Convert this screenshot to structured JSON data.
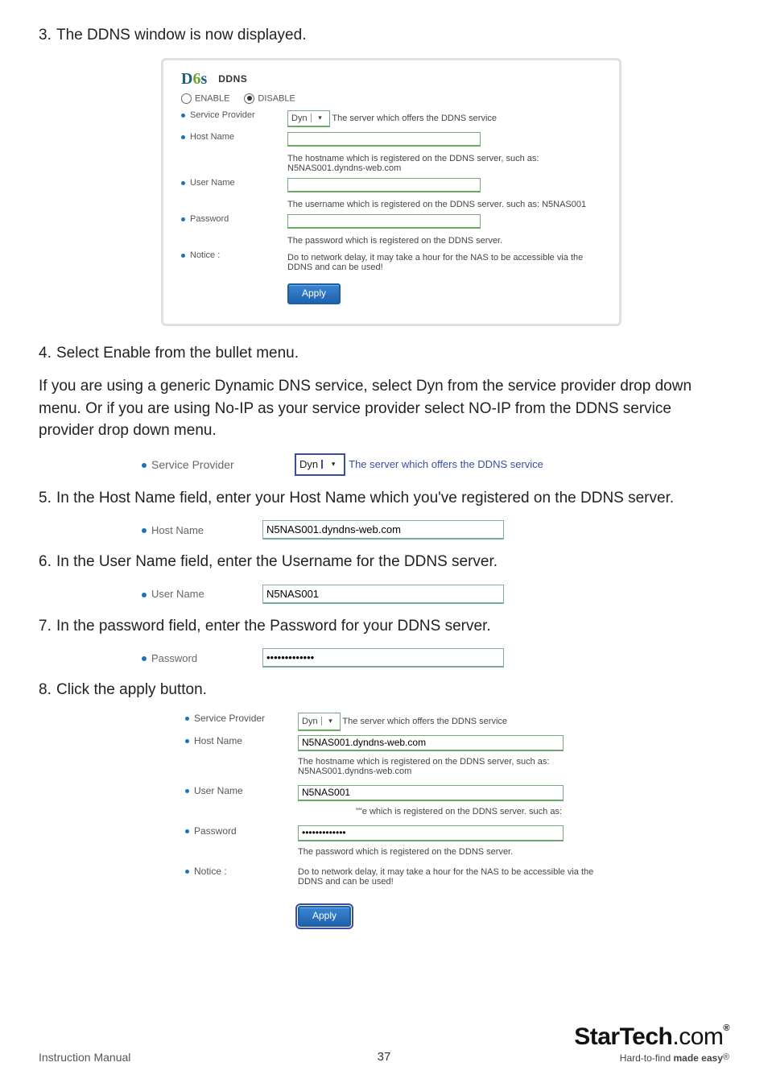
{
  "steps": {
    "s3": "The DDNS window is now displayed.",
    "s4": "Select Enable from the bullet menu.",
    "between45": "If you are using a generic Dynamic DNS service, select Dyn from the service provider drop down menu.  Or if you are using No-IP as your service provider select NO-IP from the DDNS service provider drop down menu.",
    "s5": "In the Host Name field, enter your Host Name which you've registered on the DDNS server.",
    "s6": "In the User Name field, enter the Username for the DDNS server.",
    "s7": "In the password field, enter the Password for your DDNS server.",
    "s8": "Click the apply button."
  },
  "panel": {
    "title": "DDNS",
    "radio_enable": "ENABLE",
    "radio_disable": "DISABLE",
    "labels": {
      "service_provider": "Service Provider",
      "host_name": "Host Name",
      "user_name": "User Name",
      "password": "Password",
      "notice": "Notice :"
    },
    "select_value": "Dyn",
    "select_hint": "The server which offers the DDNS service",
    "host_hint": "The hostname which is registered on the DDNS server, such as: N5NAS001.dyndns-web.com",
    "user_hint": "The username which is registered on the DDNS server. such as: N5NAS001",
    "pass_hint": "The password which is registered on the DDNS server.",
    "notice_text": "Do to network delay, it may take a hour for the NAS to be accessible via the DDNS and can be used!",
    "apply": "Apply"
  },
  "crops": {
    "sp_side": "The server which offers the DDNS service",
    "host_value": "N5NAS001.dyndns-web.com",
    "user_value": "N5NAS001",
    "pass_value": "•••••••••••••"
  },
  "filled": {
    "host_value": "N5NAS001.dyndns-web.com",
    "user_value": "N5NAS001",
    "user_hint_clipped": "\"\"e which is registered on the DDNS server. such as:",
    "pass_value": "•••••••••••••"
  },
  "footer": {
    "left": "Instruction Manual",
    "page": "37",
    "brand_main": "StarTech",
    "brand_dotcom": ".com",
    "brand_tag_lead": "Hard-to-find ",
    "brand_tag_bold": "made easy",
    "reg": "®"
  }
}
